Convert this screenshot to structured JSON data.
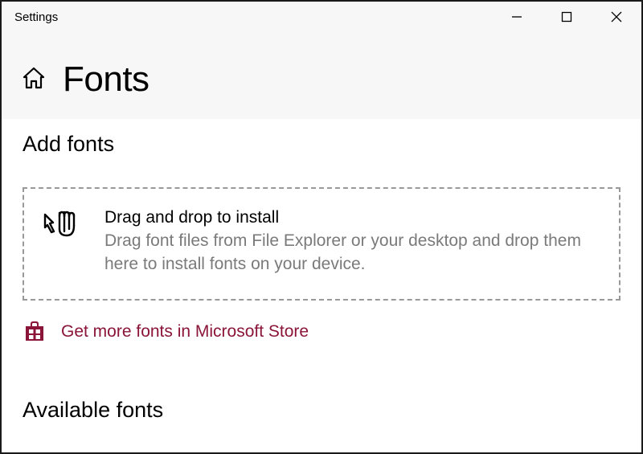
{
  "window": {
    "title": "Settings"
  },
  "page": {
    "title": "Fonts"
  },
  "sections": {
    "add_fonts": "Add fonts",
    "available_fonts": "Available fonts"
  },
  "dropzone": {
    "title": "Drag and drop to install",
    "description": "Drag font files from File Explorer or your desktop and drop them here to install fonts on your device."
  },
  "store_link": {
    "label": "Get more fonts in Microsoft Store"
  },
  "colors": {
    "accent": "#8a1538"
  }
}
